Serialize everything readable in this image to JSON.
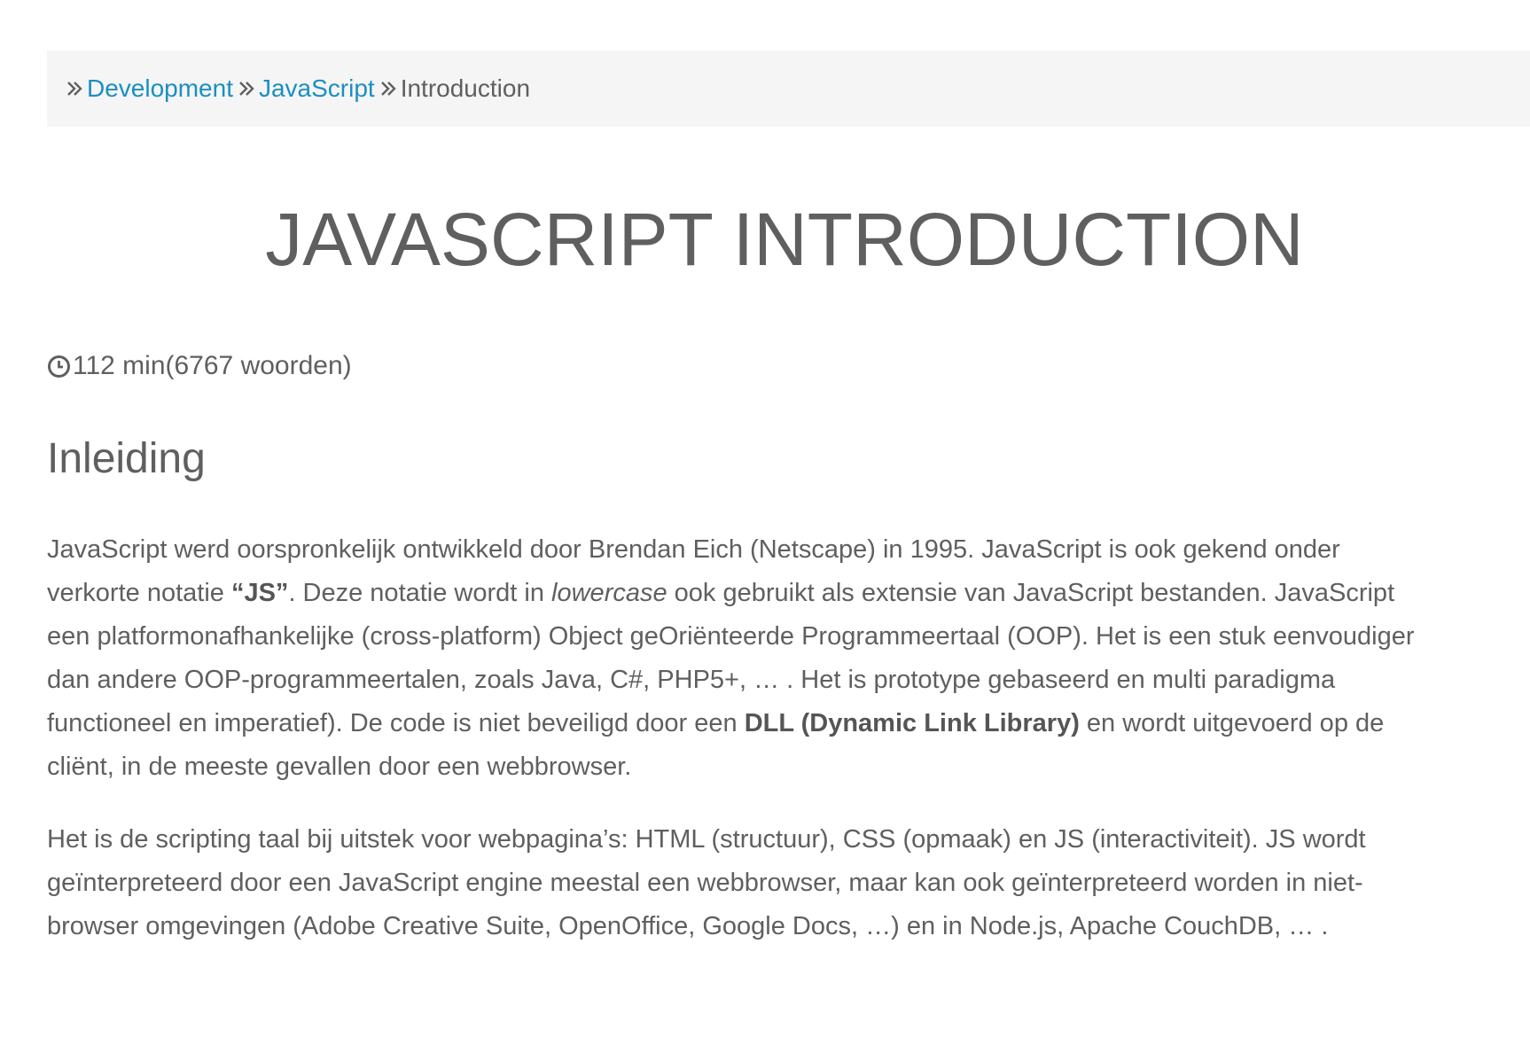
{
  "breadcrumb": {
    "items": [
      {
        "label": "Development"
      },
      {
        "label": "JavaScript"
      }
    ],
    "current": "Introduction"
  },
  "page": {
    "title": "JAVASCRIPT INTRODUCTION",
    "reading_time": "112 min(6767 woorden)",
    "section_heading": "Inleiding"
  },
  "paragraphs": {
    "p1": {
      "l1": "JavaScript werd oorspronkelijk ontwikkeld door Brendan Eich (Netscape) in 1995. JavaScript is ook gekend onder",
      "l2_a": "verkorte notatie ",
      "l2_b": "“JS”",
      "l2_c": ". Deze notatie wordt in ",
      "l2_d": "lowercase",
      "l2_e": " ook gebruikt als extensie van JavaScript bestanden. JavaScript",
      "l3": "een platformonafhankelijke (cross-platform) Object geOriënteerde Programmeertaal (OOP). Het is een stuk eenvoudiger",
      "l4": "dan andere OOP-programmeertalen, zoals Java, C#, PHP5+, … . Het is prototype gebaseerd en multi paradigma",
      "l5_a": "functioneel en imperatief). De code is niet beveiligd door een ",
      "l5_b": "DLL (Dynamic Link Library)",
      "l5_c": " en wordt uitgevoerd op de",
      "l6": "cliënt, in de meeste gevallen door een webbrowser."
    },
    "p2": {
      "l1": "Het is de scripting taal bij uitstek voor webpagina’s: HTML (structuur), CSS (opmaak) en JS (interactiviteit). JS wordt",
      "l2": "geïnterpreteerd door een JavaScript engine meestal een webbrowser, maar kan ook geïnterpreteerd worden in niet-",
      "l3": "browser omgevingen (Adobe Creative Suite, OpenOffice, Google Docs, …) en in Node.js, Apache CouchDB, … ."
    }
  },
  "colors": {
    "link": "#1a8fc1",
    "text": "#5f5f5f",
    "breadcrumb_bg": "#f5f5f5"
  },
  "icons": {
    "separator": "double-chevron-right-icon",
    "reading_time": "clock-icon"
  }
}
